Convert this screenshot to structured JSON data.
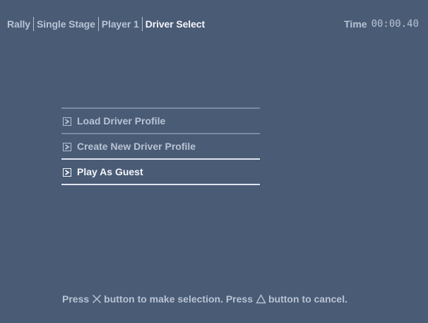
{
  "breadcrumb": {
    "items": [
      {
        "label": "Rally"
      },
      {
        "label": "Single Stage"
      },
      {
        "label": "Player 1"
      },
      {
        "label": "Driver Select"
      }
    ]
  },
  "timer": {
    "label": "Time",
    "value": "00:00.40"
  },
  "menu": {
    "items": [
      {
        "label": "Load Driver Profile",
        "selected": false,
        "icon": "arrow-right-icon"
      },
      {
        "label": "Create New Driver Profile",
        "selected": false,
        "icon": "arrow-right-icon"
      },
      {
        "label": "Play As Guest",
        "selected": true,
        "icon": "arrow-right-icon"
      }
    ]
  },
  "hint": {
    "part1": "Press",
    "button1_icon": "cross-button-icon",
    "part2": "button to make selection.  Press",
    "button2_icon": "triangle-button-icon",
    "part3": "button to cancel."
  },
  "colors": {
    "background": "#4a5b76",
    "text_dim": "#b8c3d3",
    "text_bright": "#f3f6fa"
  }
}
